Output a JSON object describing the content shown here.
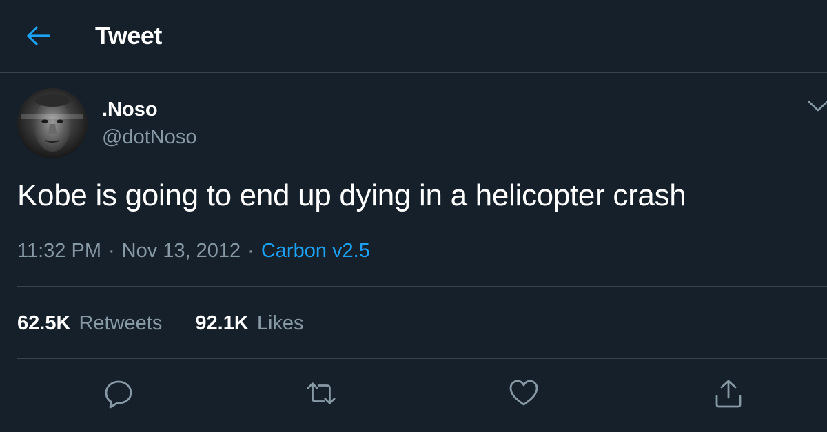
{
  "header": {
    "title": "Tweet",
    "back_icon": "arrow-left-icon"
  },
  "colors": {
    "background": "#15202b",
    "accent": "#1da1f2",
    "secondary_text": "#8899a6",
    "divider": "#38444d"
  },
  "author": {
    "display_name": ".Noso",
    "handle": "@dotNoso"
  },
  "tweet": {
    "text": "Kobe is going to end up dying in a helicopter crash",
    "time": "11:32 PM",
    "date": "Nov 13, 2012",
    "separator": "·",
    "source": "Carbon v2.5"
  },
  "stats": {
    "retweets_count": "62.5K",
    "retweets_label": "Retweets",
    "likes_count": "92.1K",
    "likes_label": "Likes"
  },
  "actions": [
    {
      "icon": "reply-icon"
    },
    {
      "icon": "retweet-icon"
    },
    {
      "icon": "heart-icon"
    },
    {
      "icon": "share-icon"
    }
  ]
}
